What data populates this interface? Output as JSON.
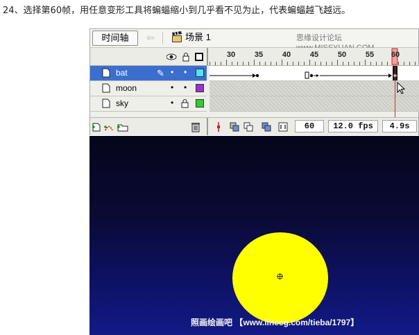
{
  "instruction": "24、选择第60帧，用任意变形工具将蝙蝠缩小到几乎看不见为止，代表蝙蝠越飞越远。",
  "timeline": {
    "tab_label": "时间轴",
    "scene_label": "场景 1",
    "watermark": "思缘设计论坛 www.MISSYUAN.COM",
    "ruler_ticks": [
      "30",
      "35",
      "40",
      "45",
      "50",
      "55",
      "60"
    ],
    "current_frame_marker": "60",
    "layers": [
      {
        "name": "bat",
        "selected": true,
        "color": "#55e0ff"
      },
      {
        "name": "moon",
        "selected": false,
        "color": "#9933cc"
      },
      {
        "name": "sky",
        "selected": false,
        "color": "#33cc33",
        "locked": true
      }
    ],
    "status": {
      "frame": "60",
      "fps": "12.0 fps",
      "time": "4.9s"
    }
  },
  "stage": {
    "watermark": "照画绘画吧 【www.linecg.com/tieba/1797】",
    "moon_color": "#ffff00"
  }
}
